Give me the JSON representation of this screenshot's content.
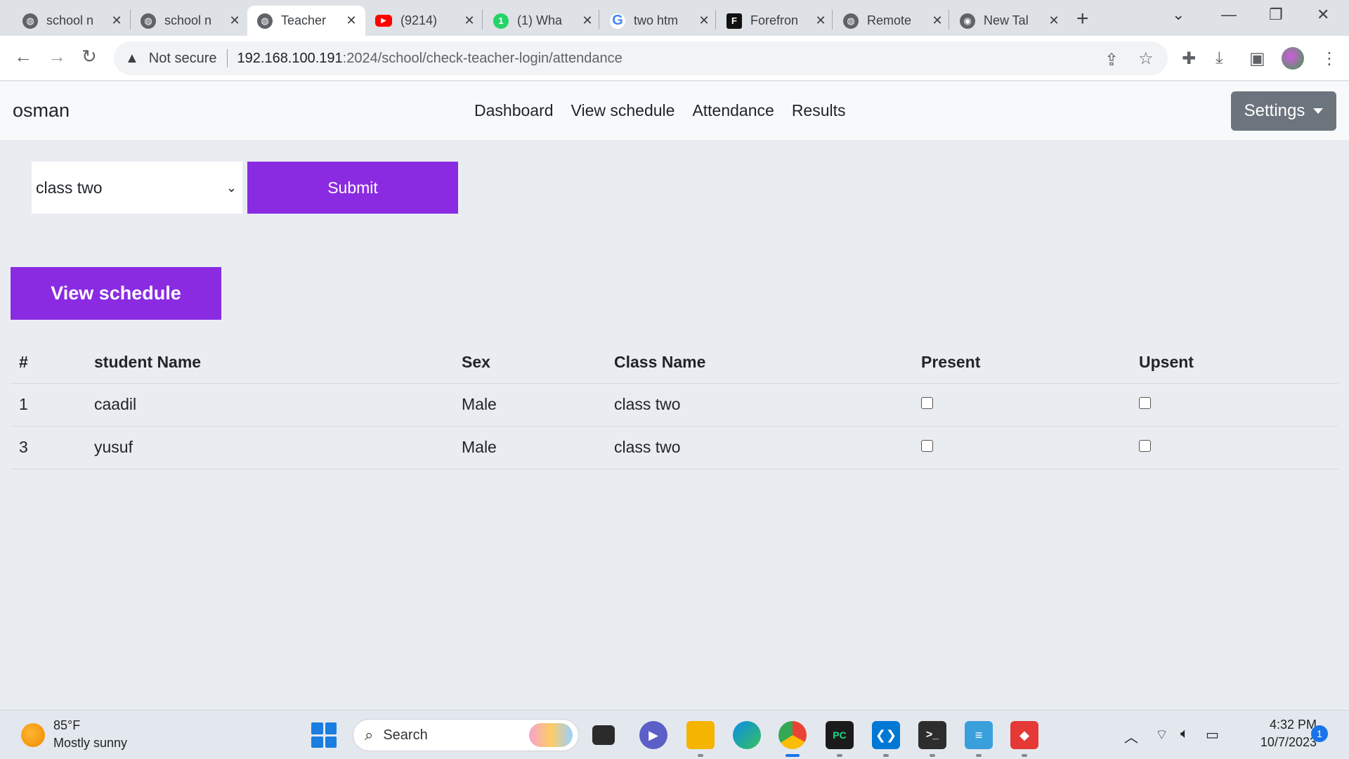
{
  "browser": {
    "tabs": [
      {
        "title": "school n",
        "favicon": "globe-icon",
        "color": "#5f6368",
        "active": false
      },
      {
        "title": "school n",
        "favicon": "globe-icon",
        "color": "#5f6368",
        "active": false
      },
      {
        "title": "Teacher",
        "favicon": "globe-icon",
        "color": "#5f6368",
        "active": true
      },
      {
        "title": "(9214)",
        "favicon": "youtube-icon",
        "color": "#ff0000",
        "active": false
      },
      {
        "title": "(1) Wha",
        "favicon": "whatsapp-icon",
        "color": "#25d366",
        "active": false
      },
      {
        "title": "two htm",
        "favicon": "google-icon",
        "color": "#4285f4",
        "active": false
      },
      {
        "title": "Forefron",
        "favicon": "forefront-icon",
        "color": "#111111",
        "active": false
      },
      {
        "title": "Remote",
        "favicon": "globe-icon",
        "color": "#5f6368",
        "active": false
      },
      {
        "title": "New Tal",
        "favicon": "chrome-icon",
        "color": "#5f6368",
        "active": false
      }
    ],
    "security_label": "Not secure",
    "url_host": "192.168.100.191",
    "url_path": ":2024/school/check-teacher-login/attendance"
  },
  "navbar": {
    "brand": "osman",
    "links": [
      "Dashboard",
      "View schedule",
      "Attendance",
      "Results"
    ],
    "settings_label": "Settings"
  },
  "form": {
    "selected_class": "class two",
    "submit_label": "Submit"
  },
  "view_schedule_label": "View schedule",
  "table": {
    "headers": [
      "#",
      "student Name",
      "Sex",
      "Class Name",
      "Present",
      "Upsent"
    ],
    "rows": [
      {
        "id": "1",
        "name": "caadil",
        "sex": "Male",
        "class": "class two",
        "present": false,
        "absent": false
      },
      {
        "id": "3",
        "name": "yusuf",
        "sex": "Male",
        "class": "class two",
        "present": false,
        "absent": false
      }
    ]
  },
  "colors": {
    "accent": "#8a2be2",
    "settings_button": "#6c757d",
    "page_background": "#e9edf2"
  },
  "taskbar": {
    "temperature": "85°F",
    "weather": "Mostly sunny",
    "search_placeholder": "Search",
    "apps": [
      "file-explorer-icon",
      "teams-icon",
      "folder-icon",
      "edge-icon",
      "chrome-icon",
      "pycharm-icon",
      "vscode-icon",
      "terminal-icon",
      "notepad-icon",
      "git-icon"
    ],
    "time": "4:32 PM",
    "date": "10/7/2023",
    "notifications": "1"
  }
}
